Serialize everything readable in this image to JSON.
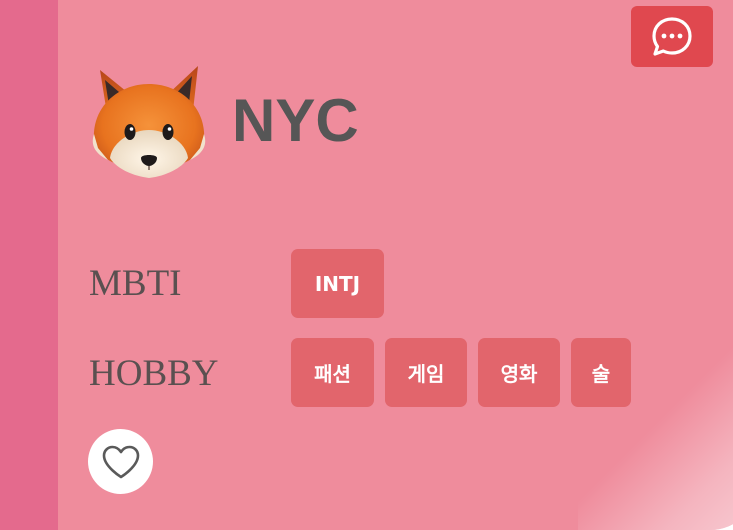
{
  "profile": {
    "name": "NYC",
    "avatar_icon": "fox-face-icon"
  },
  "mbti": {
    "label": "MBTI",
    "value": "INTJ"
  },
  "hobby": {
    "label": "HOBBY",
    "tags": [
      "패션",
      "게임",
      "영화",
      "술"
    ]
  },
  "actions": {
    "chat_icon": "chat-bubble-icon",
    "like_icon": "heart-outline-icon"
  },
  "colors": {
    "left_strip": "#e46a8d",
    "card_bg": "#ef8c9c",
    "chat_button": "#e0484f",
    "tag_bg": "#e2656c",
    "name_text": "#565656"
  }
}
